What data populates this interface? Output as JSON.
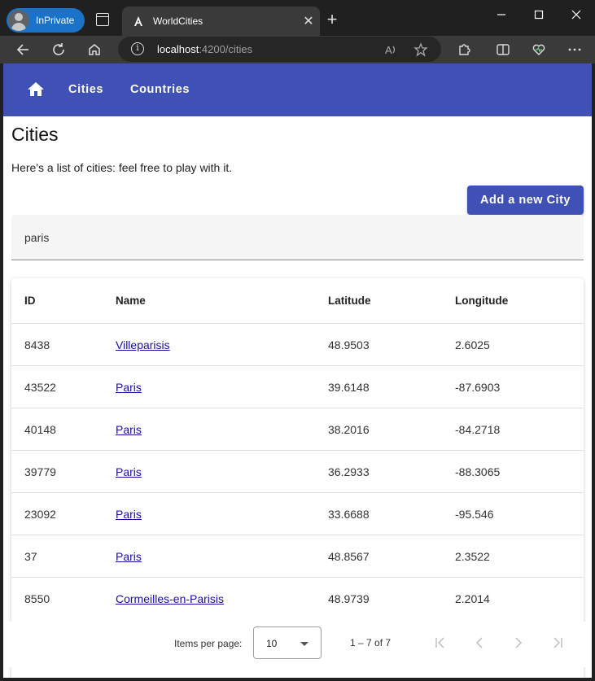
{
  "browser": {
    "inprivate_label": "InPrivate",
    "tab_title": "WorldCities",
    "url_host": "localhost",
    "url_rest": ":4200/cities"
  },
  "nav": {
    "home_icon": "home-icon",
    "cities": "Cities",
    "countries": "Countries"
  },
  "page": {
    "title": "Cities",
    "intro": "Here's a list of cities: feel free to play with it.",
    "add_button": "Add a new City",
    "filter_value": "paris"
  },
  "table": {
    "headers": {
      "id": "ID",
      "name": "Name",
      "lat": "Latitude",
      "lon": "Longitude"
    },
    "rows": [
      {
        "id": "8438",
        "name": "Villeparisis",
        "lat": "48.9503",
        "lon": "2.6025"
      },
      {
        "id": "43522",
        "name": "Paris",
        "lat": "39.6148",
        "lon": "-87.6903"
      },
      {
        "id": "40148",
        "name": "Paris",
        "lat": "38.2016",
        "lon": "-84.2718"
      },
      {
        "id": "39779",
        "name": "Paris",
        "lat": "36.2933",
        "lon": "-88.3065"
      },
      {
        "id": "23092",
        "name": "Paris",
        "lat": "33.6688",
        "lon": "-95.546"
      },
      {
        "id": "37",
        "name": "Paris",
        "lat": "48.8567",
        "lon": "2.3522"
      },
      {
        "id": "8550",
        "name": "Cormeilles-en-Parisis",
        "lat": "48.9739",
        "lon": "2.2014"
      }
    ]
  },
  "paginator": {
    "items_per_page_label": "Items per page:",
    "page_size": "10",
    "range": "1 – 7 of 7"
  },
  "colors": {
    "primary": "#3f51b5",
    "link": "#1a0dab",
    "chrome_dark": "#202020",
    "chrome_toolbar": "#3a3a3a"
  }
}
